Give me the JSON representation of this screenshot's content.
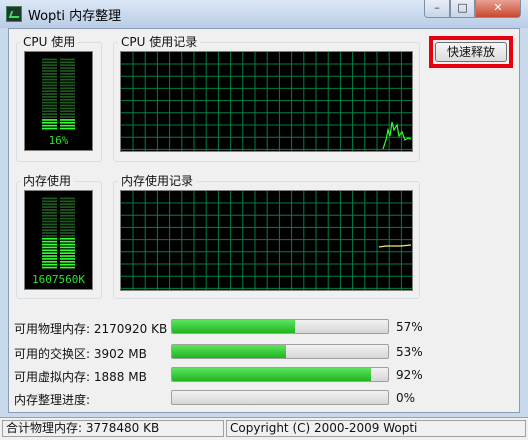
{
  "window": {
    "title": "Wopti 内存整理",
    "minimize_glyph": "–",
    "maximize_glyph": "□",
    "close_glyph": "✕"
  },
  "cpu": {
    "usage_label": "CPU 使用",
    "usage_value": "16%",
    "usage_fraction": 0.16,
    "history_label": "CPU 使用记录"
  },
  "memory": {
    "usage_label": "内存使用",
    "usage_value": "1607560K",
    "usage_fraction": 0.43,
    "history_label": "内存使用记录"
  },
  "fast_release_button": "快速释放",
  "stats": [
    {
      "label": "可用物理内存: 2170920 KB",
      "percent": "57%",
      "fraction": 0.57
    },
    {
      "label": "可用的交换区: 3902 MB",
      "percent": "53%",
      "fraction": 0.53
    },
    {
      "label": "可用虚拟内存: 1888 MB",
      "percent": "92%",
      "fraction": 0.92
    },
    {
      "label": "内存整理进度:",
      "percent": "0%",
      "fraction": 0
    }
  ],
  "status": {
    "total": "合计物理内存: 3778480 KB",
    "copyright": "Copyright (C) 2000-2009 Wopti"
  },
  "colors": {
    "graph_grid": "#008040",
    "cpu_line": "#30ff30",
    "mem_line": "#f0f070",
    "highlight_box": "#e8000e"
  }
}
